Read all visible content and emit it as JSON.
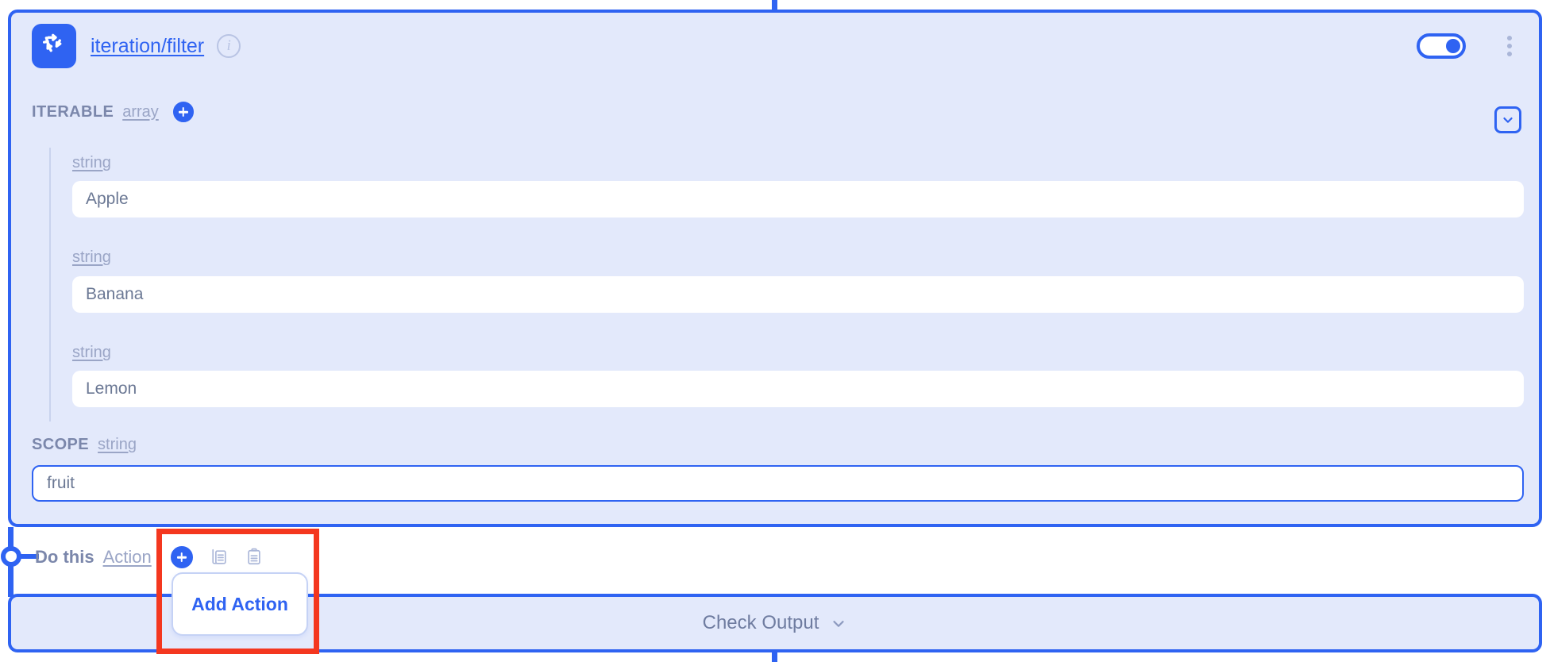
{
  "node": {
    "icon": "iteration-loop-icon",
    "title": "iteration/filter",
    "info_icon": "info-icon",
    "toggle": {
      "name": "enable-toggle",
      "state": "on"
    },
    "menu_icon": "kebab-menu-icon",
    "collapse_icon": "chevron-down-icon"
  },
  "iterable": {
    "label": "ITERABLE",
    "type": "array",
    "add_icon": "plus-circle-icon",
    "items": [
      {
        "type": "string",
        "value": "Apple"
      },
      {
        "type": "string",
        "value": "Banana"
      },
      {
        "type": "string",
        "value": "Lemon"
      }
    ]
  },
  "scope": {
    "label": "SCOPE",
    "type": "string",
    "value": "fruit",
    "focused": true
  },
  "do_this": {
    "prefix": "Do this",
    "link": "Action",
    "add_icon": "plus-circle-icon",
    "copy_icon": "copy-icon",
    "paste_icon": "paste-clipboard-icon"
  },
  "tooltip": {
    "label": "Add Action"
  },
  "check_output": {
    "label": "Check Output",
    "chevron_icon": "chevron-down-icon"
  },
  "colors": {
    "accent_blue": "#2f63f2",
    "card_bg": "#e3e9fb",
    "muted_text": "#7b87ab",
    "link_muted": "#9aa5c6",
    "annotation_red": "#f4371f",
    "input_bg": "#ffffff"
  }
}
